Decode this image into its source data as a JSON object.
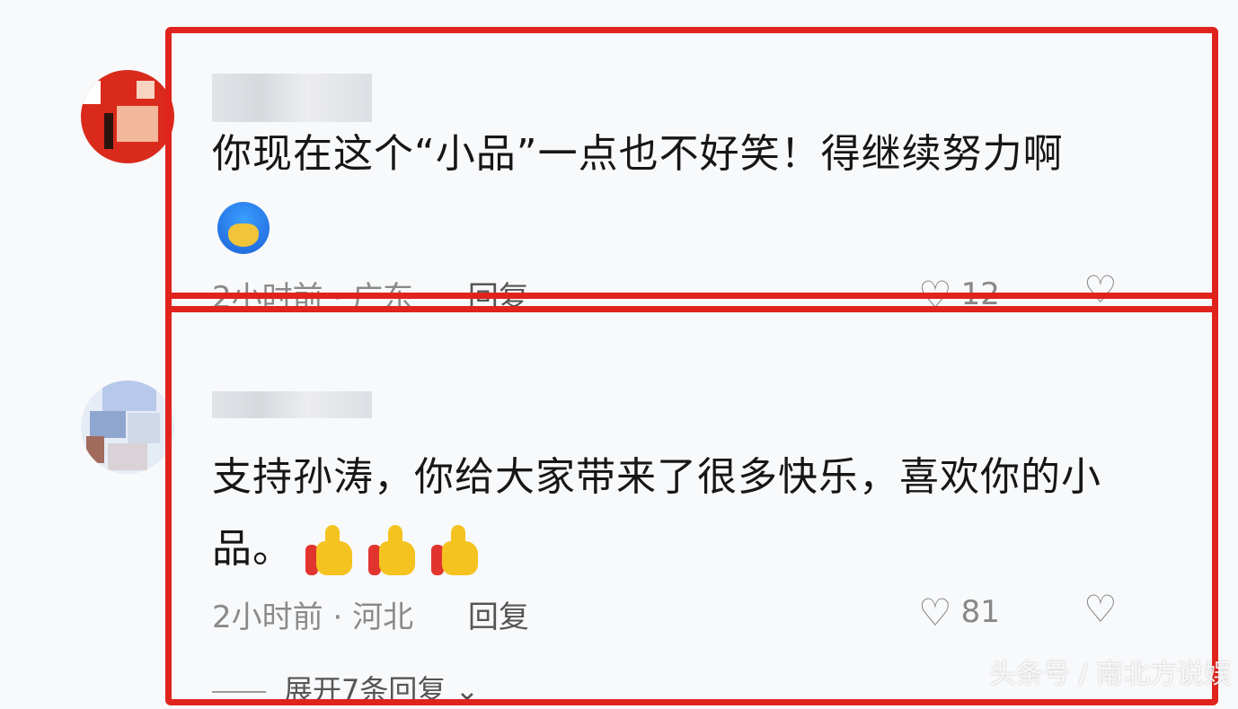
{
  "comments": [
    {
      "text": "你现在这个“小品”一点也不好笑！得继续努力啊",
      "emoji": "crying-blue-face-emoji",
      "time": "2小时前",
      "location": "广东",
      "reply_label": "回复",
      "likes": "12"
    },
    {
      "text": "支持孙涛，你给大家带来了很多快乐，喜欢你的小品。",
      "emoji": "thumbs-up-emoji",
      "time": "2小时前",
      "location": "河北",
      "reply_label": "回复",
      "likes": "81",
      "expand_label": "展开7条回复"
    }
  ],
  "watermark": "头条号 / 南北方说娱",
  "colors": {
    "highlight": "#e0231c",
    "background": "#f8f9fb"
  }
}
